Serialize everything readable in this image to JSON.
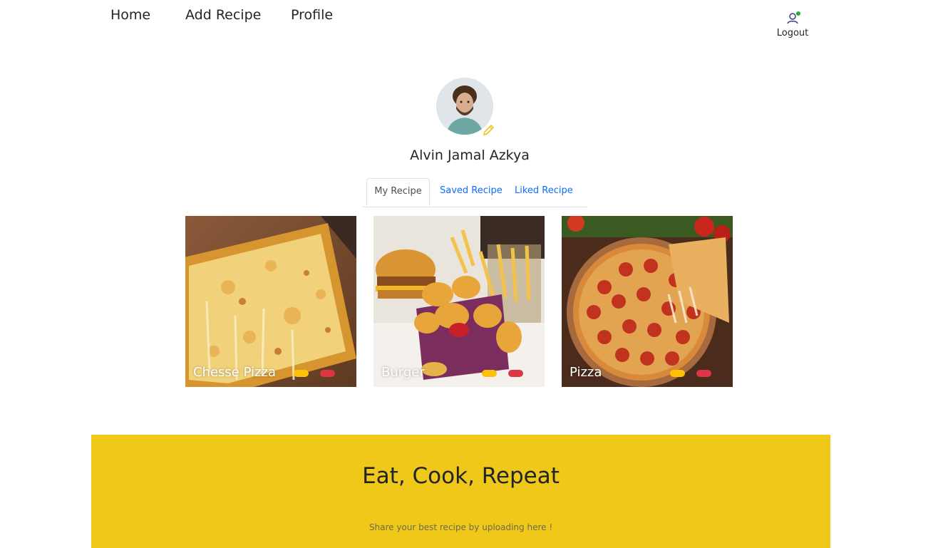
{
  "nav": {
    "home_label": "Home",
    "add_recipe_label": "Add Recipe",
    "profile_label": "Profile",
    "logout_label": "Logout",
    "logout_icon": "user-icon",
    "online_status_color": "#28a745"
  },
  "profile": {
    "name": "Alvin Jamal Azkya",
    "edit_icon": "pencil-icon"
  },
  "tabs": [
    {
      "label": "My Recipe",
      "active": true
    },
    {
      "label": "Saved Recipe",
      "active": false
    },
    {
      "label": "Liked Recipe",
      "active": false
    }
  ],
  "recipes": [
    {
      "title": "Chesse Pizza"
    },
    {
      "title": "Burger"
    },
    {
      "title": "Pizza"
    }
  ],
  "banner": {
    "title": "Eat, Cook, Repeat",
    "subtitle": "Share your best recipe by uploading here !",
    "background": "#efc81a"
  },
  "colors": {
    "accent_link": "#0d6efd",
    "pill_yellow": "#ffc107",
    "pill_red": "#dc3545"
  }
}
